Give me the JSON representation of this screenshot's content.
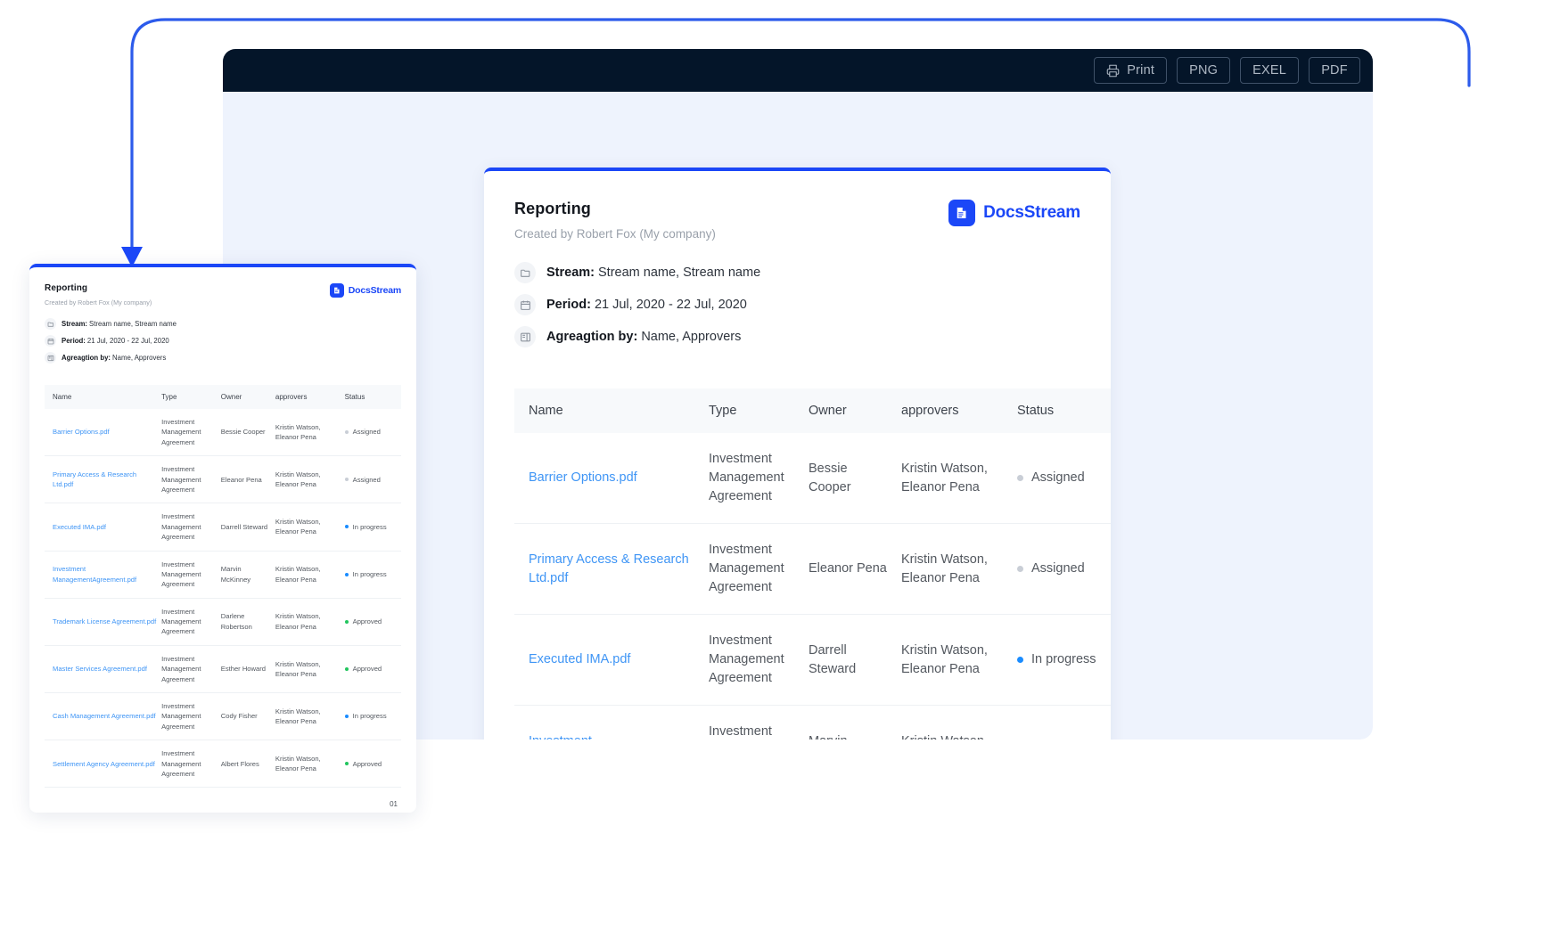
{
  "toolbar": {
    "buttons": [
      {
        "label": "Print",
        "icon": "printer-icon"
      },
      {
        "label": "PNG",
        "icon": null
      },
      {
        "label": "EXEL",
        "icon": null
      },
      {
        "label": "PDF",
        "icon": null
      }
    ]
  },
  "brand": {
    "name": "DocsStream",
    "color": "#1b47f7"
  },
  "report": {
    "title": "Reporting",
    "subtitle": "Created by Robert Fox (My company)",
    "meta": [
      {
        "icon": "folder-icon",
        "key": "Stream",
        "sep": ": ",
        "value": "Stream name, Stream name"
      },
      {
        "icon": "calendar-icon",
        "key": "Period",
        "sep": ": ",
        "value": "21 Jul, 2020 - 22 Jul, 2020"
      },
      {
        "icon": "layout-icon",
        "key": "Agreagtion by",
        "sep": ": ",
        "value": "Name, Approvers"
      }
    ],
    "page_number": "01"
  },
  "table": {
    "columns": [
      "Name",
      "Type",
      "Owner",
      "approvers",
      "Status"
    ],
    "rows": [
      {
        "name": "Barrier Options.pdf",
        "type": "Investment Management Agreement",
        "owner": "Bessie Cooper",
        "approvers": "Kristin Watson, Eleanor Pena",
        "status": "Assigned",
        "status_color": "#c9ced6"
      },
      {
        "name": "Primary Access & Research Ltd.pdf",
        "type": "Investment Management Agreement",
        "owner": "Eleanor Pena",
        "approvers": "Kristin Watson, Eleanor Pena",
        "status": "Assigned",
        "status_color": "#c9ced6"
      },
      {
        "name": "Executed IMA.pdf",
        "type": "Investment Management Agreement",
        "owner": "Darrell Steward",
        "approvers": "Kristin Watson, Eleanor Pena",
        "status": "In progress",
        "status_color": "#1a8cff"
      },
      {
        "name": "Investment ManagementAgreement.pdf",
        "type": "Investment Management Agreement",
        "owner": "Marvin McKinney",
        "approvers": "Kristin Watson, Eleanor Pena",
        "status": "In progress",
        "status_color": "#1a8cff"
      },
      {
        "name": "Trademark License Agreement.pdf",
        "type": "Investment Management Agreement",
        "owner": "Darlene Robertson",
        "approvers": "Kristin Watson, Eleanor Pena",
        "status": "Approved",
        "status_color": "#22c55e"
      },
      {
        "name": "Master Services Agreement.pdf",
        "type": "Investment Management Agreement",
        "owner": "Esther Howard",
        "approvers": "Kristin Watson, Eleanor Pena",
        "status": "Approved",
        "status_color": "#22c55e"
      },
      {
        "name": "Cash Management Agreement.pdf",
        "type": "Investment Management Agreement",
        "owner": "Cody Fisher",
        "approvers": "Kristin Watson, Eleanor Pena",
        "status": "In progress",
        "status_color": "#1a8cff"
      },
      {
        "name": "Settlement Agency Agreement.pdf",
        "type": "Investment Management Agreement",
        "owner": "Albert Flores",
        "approvers": "Kristin Watson, Eleanor Pena",
        "status": "Approved",
        "status_color": "#22c55e"
      }
    ],
    "large_visible_rows": 5
  },
  "colors": {
    "toolbar_bg": "#041529",
    "viewer_bg": "#eef3fd",
    "accent": "#1b47f7",
    "link": "#3f95f5"
  }
}
